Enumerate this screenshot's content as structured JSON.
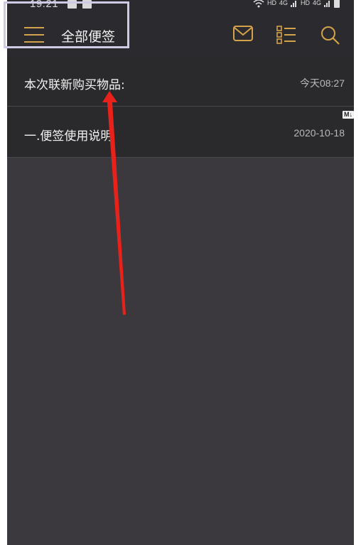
{
  "status_bar": {
    "time": "19:21",
    "network_label_1": "HD",
    "network_label_2": "HD",
    "network_type_1": "4G",
    "network_type_2": "4G"
  },
  "toolbar": {
    "title": "全部便签",
    "icons": [
      "menu-icon",
      "mail-icon",
      "list-view-icon",
      "search-icon"
    ],
    "accent_color": "#d4a24a"
  },
  "notes": [
    {
      "title": "本次联新购买物品:",
      "date": "今天08:27",
      "badge": ""
    },
    {
      "title": "一.便签使用说明",
      "date": "2020-10-18",
      "badge": "M↓"
    }
  ],
  "annotation": {
    "highlight_color": "#cfcbe6",
    "arrow_color": "#e8221b"
  }
}
